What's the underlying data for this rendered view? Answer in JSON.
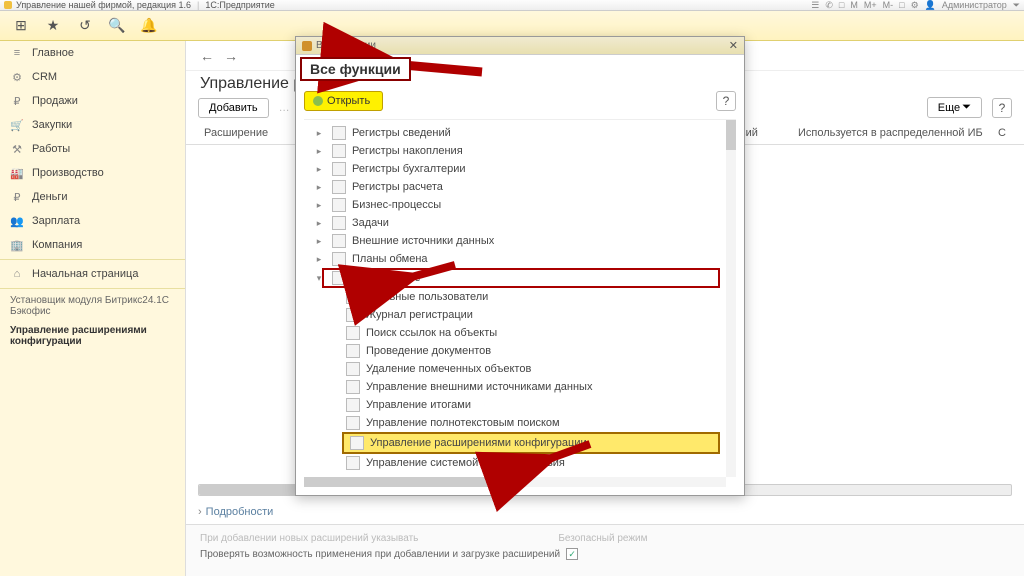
{
  "titlebar": {
    "app_label": "Управление нашей фирмой, редакция 1.6",
    "product": "1С:Предприятие",
    "user": "Администратор",
    "icons": [
      "☰",
      "✆",
      "□",
      "M",
      "M+",
      "M-",
      "□",
      "⚙",
      "?"
    ]
  },
  "topbar_icons": [
    "grid",
    "star",
    "clock",
    "search",
    "bell"
  ],
  "nav": {
    "back": "←",
    "fwd": "→"
  },
  "sidebar": {
    "items": [
      {
        "icon": "≡",
        "label": "Главное"
      },
      {
        "icon": "⚙",
        "label": "CRM"
      },
      {
        "icon": "₽",
        "label": "Продажи"
      },
      {
        "icon": "🛒",
        "label": "Закупки"
      },
      {
        "icon": "⚒",
        "label": "Работы"
      },
      {
        "icon": "🏭",
        "label": "Производство"
      },
      {
        "icon": "₽",
        "label": "Деньги"
      },
      {
        "icon": "👥",
        "label": "Зарплата"
      },
      {
        "icon": "🏢",
        "label": "Компания"
      }
    ],
    "start_page": {
      "icon": "⌂",
      "label": "Начальная страница"
    },
    "subs": [
      "Установщик модуля Битрикс24.1С Бэкофис",
      "Управление расширениями конфигурации"
    ]
  },
  "page": {
    "title": "Управление расширениями конфигурации",
    "add_btn": "Добавить",
    "more_btn": "Еще",
    "help": "?",
    "cols": {
      "c1": "Расширение",
      "c2": "",
      "c3": "ных действий",
      "c4": "Используется в распределенной ИБ",
      "c5": "С"
    }
  },
  "footer": {
    "toggle": "Подробности",
    "faded1": "При добавлении новых расширений указывать",
    "faded2": "Безопасный режим",
    "check_label": "Проверять возможность применения при добавлении и загрузке расширений",
    "checked": "✓"
  },
  "modal": {
    "titlebar": "Все функции",
    "highlight_title": "Все функции",
    "open_btn": "Открыть",
    "help": "?",
    "tree_parents": [
      "Регистры сведений",
      "Регистры накопления",
      "Регистры бухгалтерии",
      "Регистры расчета",
      "Бизнес-процессы",
      "Задачи",
      "Внешние источники данных",
      "Планы обмена"
    ],
    "boxed": "Стандартные",
    "tree_children": [
      "Активные пользователи",
      "Журнал регистрации",
      "Поиск ссылок на объекты",
      "Проведение документов",
      "Удаление помеченных объектов",
      "Управление внешними источниками данных",
      "Управление итогами",
      "Управление полнотекстовым поиском"
    ],
    "highlighted_child": "Управление расширениями конфигурации",
    "last_child": "Управление системой взаимодействия"
  }
}
